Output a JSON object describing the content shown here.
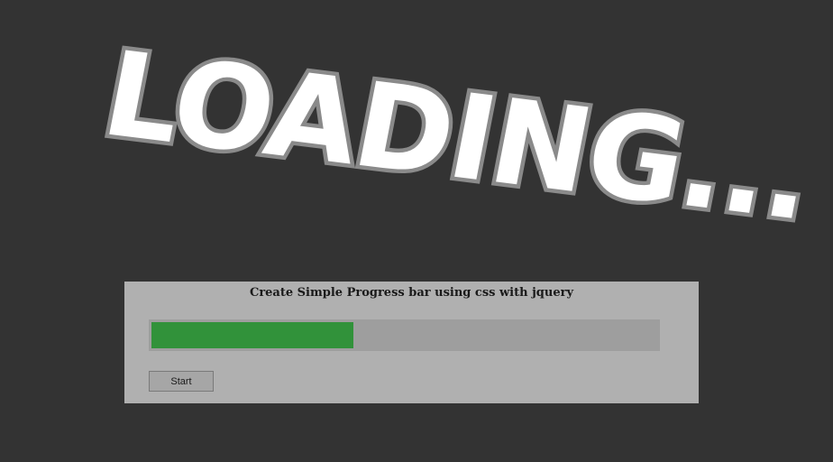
{
  "hero": {
    "text": "LOADING..."
  },
  "panel": {
    "title": "Create Simple Progress bar using css with jquery",
    "progress": {
      "fraction": 0.4
    },
    "start_label": "Start"
  },
  "colors": {
    "background": "#333333",
    "panel": "#b0b0b0",
    "track": "#9e9e9e",
    "fill": "#31923a",
    "hero_fill": "#ffffff",
    "hero_outline": "#8a8a8a"
  }
}
